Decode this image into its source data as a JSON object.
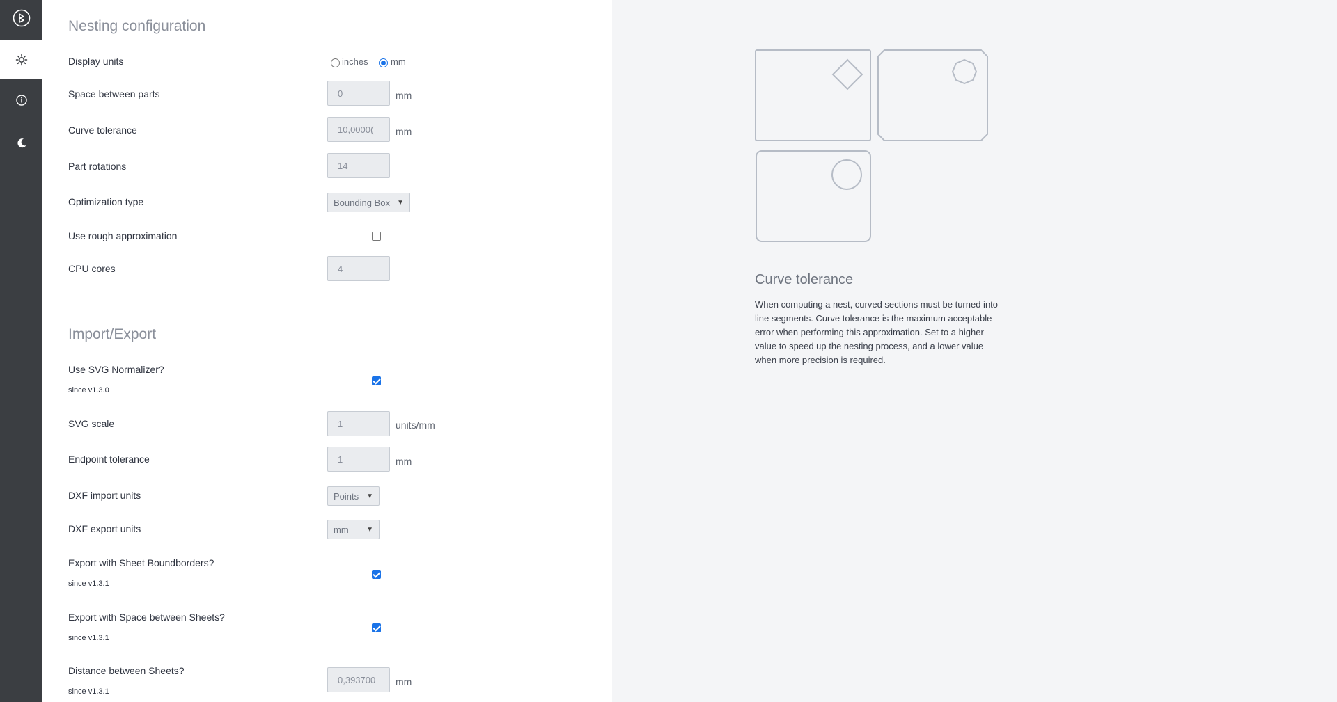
{
  "sidebar": {
    "items": [
      {
        "name": "logo",
        "icon": "deepnest-logo-icon"
      },
      {
        "name": "settings",
        "icon": "gear-icon",
        "active": true
      },
      {
        "name": "info",
        "icon": "info-icon"
      },
      {
        "name": "dark-mode",
        "icon": "moon-icon"
      }
    ]
  },
  "nesting": {
    "title": "Nesting configuration",
    "display_units": {
      "label": "Display units",
      "options": [
        "inches",
        "mm"
      ],
      "selected": "mm"
    },
    "space_between_parts": {
      "label": "Space between parts",
      "value": "0",
      "unit": "mm"
    },
    "curve_tolerance": {
      "label": "Curve tolerance",
      "value": "10,0000(",
      "unit": "mm"
    },
    "part_rotations": {
      "label": "Part rotations",
      "value": "14"
    },
    "optimization_type": {
      "label": "Optimization type",
      "value": "Bounding Box"
    },
    "rough_approximation": {
      "label": "Use rough approximation",
      "checked": false
    },
    "cpu_cores": {
      "label": "CPU cores",
      "value": "4"
    }
  },
  "import_export": {
    "title": "Import/Export",
    "svg_normalizer": {
      "label": "Use SVG Normalizer?",
      "since": "since v1.3.0",
      "checked": true
    },
    "svg_scale": {
      "label": "SVG scale",
      "value": "1",
      "unit": "units/mm"
    },
    "endpoint_tolerance": {
      "label": "Endpoint tolerance",
      "value": "1",
      "unit": "mm"
    },
    "dxf_import_units": {
      "label": "DXF import units",
      "value": "Points"
    },
    "dxf_export_units": {
      "label": "DXF export units",
      "value": "mm"
    },
    "sheet_boundborders": {
      "label": "Export with Sheet Boundborders?",
      "since": "since v1.3.1",
      "checked": true
    },
    "space_between_sheets": {
      "label": "Export with Space between Sheets?",
      "since": "since v1.3.1",
      "checked": true
    },
    "distance_between_sheets": {
      "label": "Distance between Sheets?",
      "since": "since v1.3.1",
      "value": "0,393700",
      "unit": "mm"
    }
  },
  "help": {
    "title": "Curve tolerance",
    "text": "When computing a nest, curved sections must be turned into line segments. Curve tolerance is the maximum acceptable error when performing this approximation. Set to a higher value to speed up the nesting process, and a lower value when more precision is required."
  },
  "colors": {
    "sidebar": "#3b3e42",
    "accent": "#1a73e8",
    "help_bg": "#f4f5f7"
  }
}
